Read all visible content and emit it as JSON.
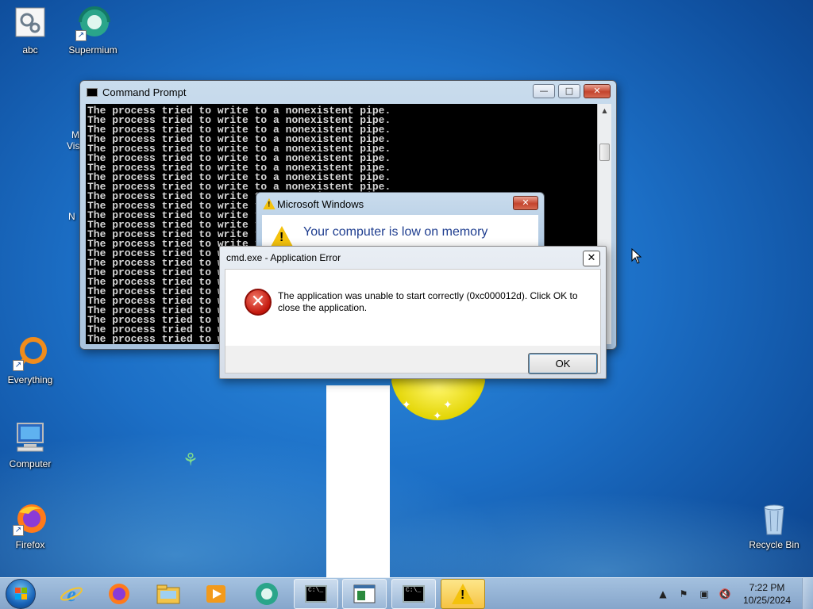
{
  "desktop": {
    "icons": [
      {
        "label": "abc",
        "icon": "settings-file-icon"
      },
      {
        "label": "Supermium",
        "icon": "supermium-icon"
      },
      {
        "label": "Everything",
        "icon": "everything-search-icon"
      },
      {
        "label": "Computer",
        "icon": "computer-icon"
      },
      {
        "label": "Firefox",
        "icon": "firefox-icon"
      },
      {
        "label": "Recycle Bin",
        "icon": "recycle-bin-icon"
      }
    ],
    "partial_labels": [
      "M",
      "Vis",
      "N"
    ]
  },
  "cmd_window": {
    "title": "Command Prompt",
    "line_text": "The process tried to write to a nonexistent pipe.",
    "line_count": 25,
    "lines_full": 9
  },
  "memory_dialog": {
    "title": "Microsoft Windows",
    "message": "Your computer is low on memory"
  },
  "error_dialog": {
    "title": "cmd.exe - Application Error",
    "message": "The application was unable to start correctly (0xc000012d). Click OK to close the application.",
    "ok_label": "OK"
  },
  "taskbar": {
    "pinned": [
      "internet-explorer-icon",
      "firefox-icon",
      "file-explorer-icon",
      "media-player-icon",
      "supermium-icon"
    ],
    "running": [
      "command-prompt",
      "window-app",
      "command-prompt",
      "warning-dialog"
    ],
    "clock": {
      "time": "7:22 PM",
      "date": "10/25/2024"
    }
  }
}
